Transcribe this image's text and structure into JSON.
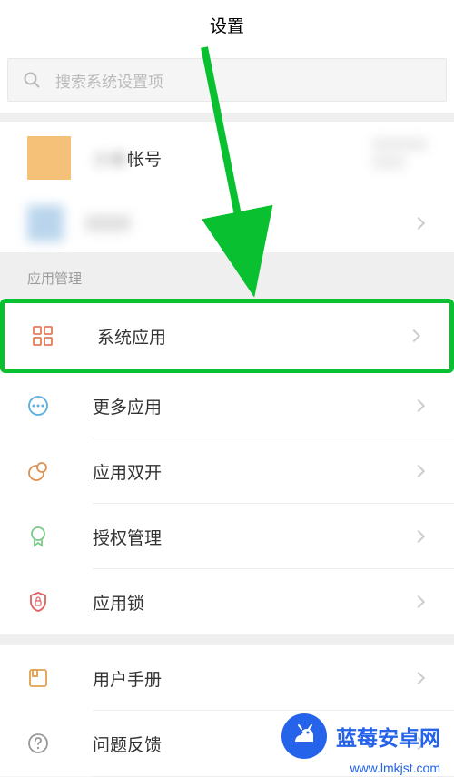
{
  "header": {
    "title": "设置"
  },
  "search": {
    "placeholder": "搜索系统设置项"
  },
  "account": {
    "label1": "帐号",
    "blurred_prefix": "小米"
  },
  "sections": {
    "app_management": "应用管理"
  },
  "menu": {
    "system_apps": "系统应用",
    "more_apps": "更多应用",
    "app_dual": "应用双开",
    "auth_management": "授权管理",
    "app_lock": "应用锁",
    "user_manual": "用户手册",
    "feedback": "问题反馈"
  },
  "watermark": {
    "name": "蓝莓安卓网",
    "url": "www.lmkjst.com"
  }
}
